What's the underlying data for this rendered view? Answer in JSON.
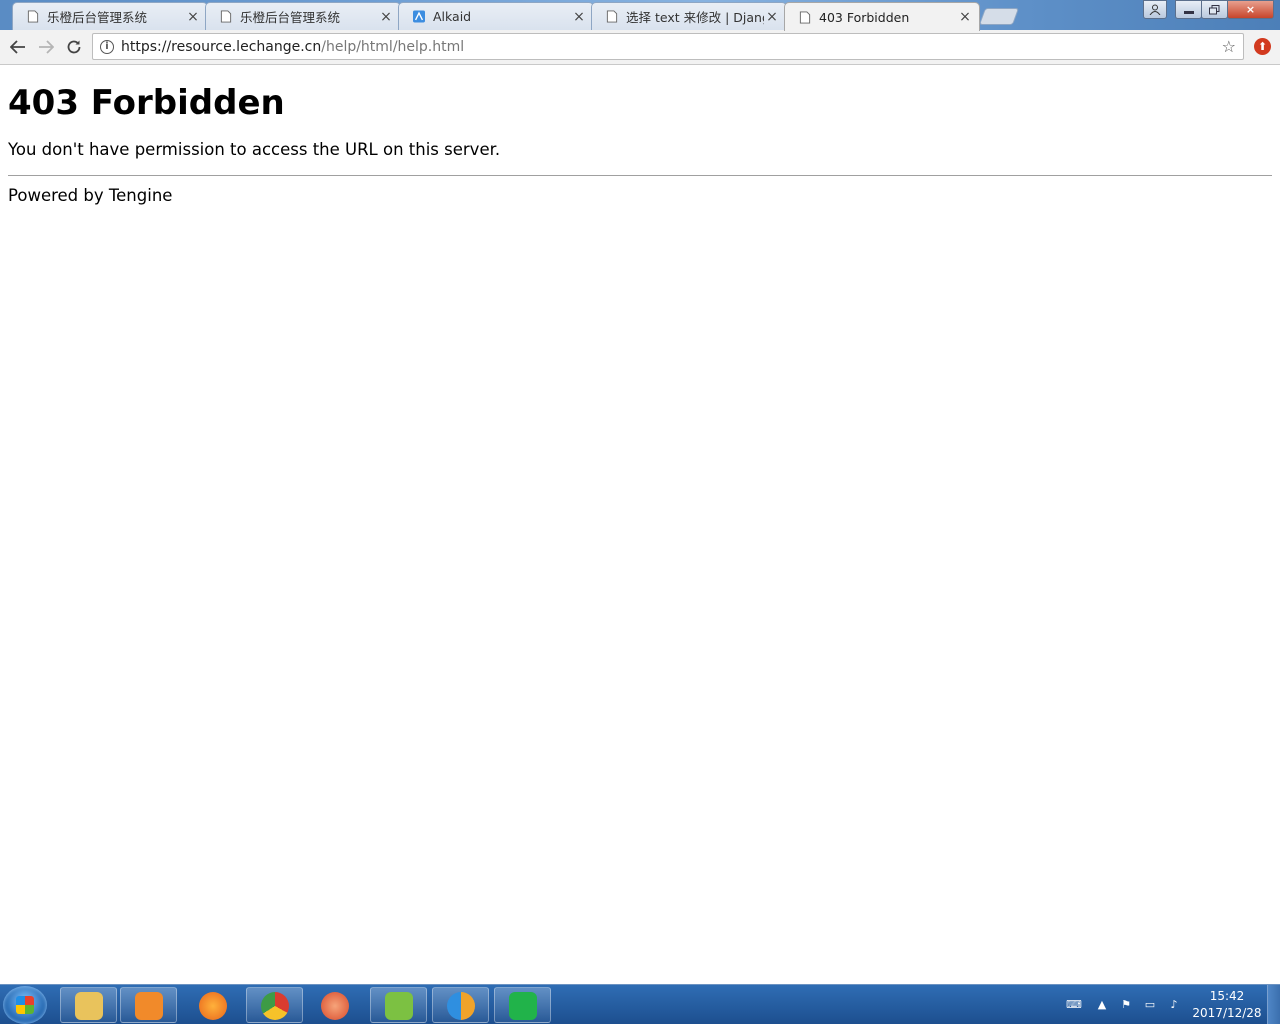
{
  "browser": {
    "tabs": [
      {
        "title": "乐橙后台管理系统",
        "icon": "page-icon"
      },
      {
        "title": "乐橙后台管理系统",
        "icon": "page-icon"
      },
      {
        "title": "Alkaid",
        "icon": "alkaid-icon"
      },
      {
        "title": "选择 text 来修改 | Djang",
        "icon": "page-icon"
      },
      {
        "title": "403 Forbidden",
        "icon": "page-icon",
        "active": true
      }
    ],
    "close_glyph": "×",
    "address": {
      "url_host": "https://resource.lechange.cn",
      "url_path": "/help/html/help.html"
    }
  },
  "page": {
    "heading": "403 Forbidden",
    "message": "You don't have permission to access the URL on this server.",
    "footer": "Powered by Tengine"
  },
  "taskbar": {
    "apps": [
      {
        "name": "file-explorer",
        "color": "#e9c35c"
      },
      {
        "name": "media-player",
        "color": "#f18a2a"
      },
      {
        "name": "firefox",
        "color": "#e8641b"
      },
      {
        "name": "chrome",
        "color": "#3d9b46"
      },
      {
        "name": "snail-app",
        "color": "#d84a2b"
      },
      {
        "name": "notepad-plus",
        "color": "#7cc142"
      },
      {
        "name": "xshell-app",
        "color": "#2f8fe0"
      },
      {
        "name": "s-app",
        "color": "#21b34a"
      }
    ],
    "clock": {
      "time": "15:42",
      "date": "2017/12/28"
    }
  }
}
